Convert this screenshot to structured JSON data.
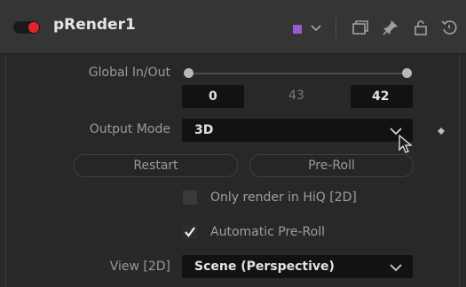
{
  "header": {
    "node_name": "pRender1",
    "toggle_color": "#e0262c",
    "swatch_color": "#9a5bd0",
    "icons": [
      "color-dropdown-chevron-icon",
      "window-icon",
      "pin-icon",
      "lock-icon",
      "reset-icon"
    ]
  },
  "global_inout": {
    "label": "Global In/Out",
    "start": "0",
    "middle": "43",
    "end": "42"
  },
  "output_mode": {
    "label": "Output Mode",
    "value": "3D"
  },
  "buttons": {
    "restart": "Restart",
    "preroll": "Pre-Roll"
  },
  "options": {
    "only_render_hiq": {
      "label": "Only render in HiQ [2D]",
      "checked": false
    },
    "automatic_preroll": {
      "label": "Automatic Pre-Roll",
      "checked": true
    }
  },
  "view": {
    "label": "View [2D]",
    "value": "Scene (Perspective)"
  }
}
